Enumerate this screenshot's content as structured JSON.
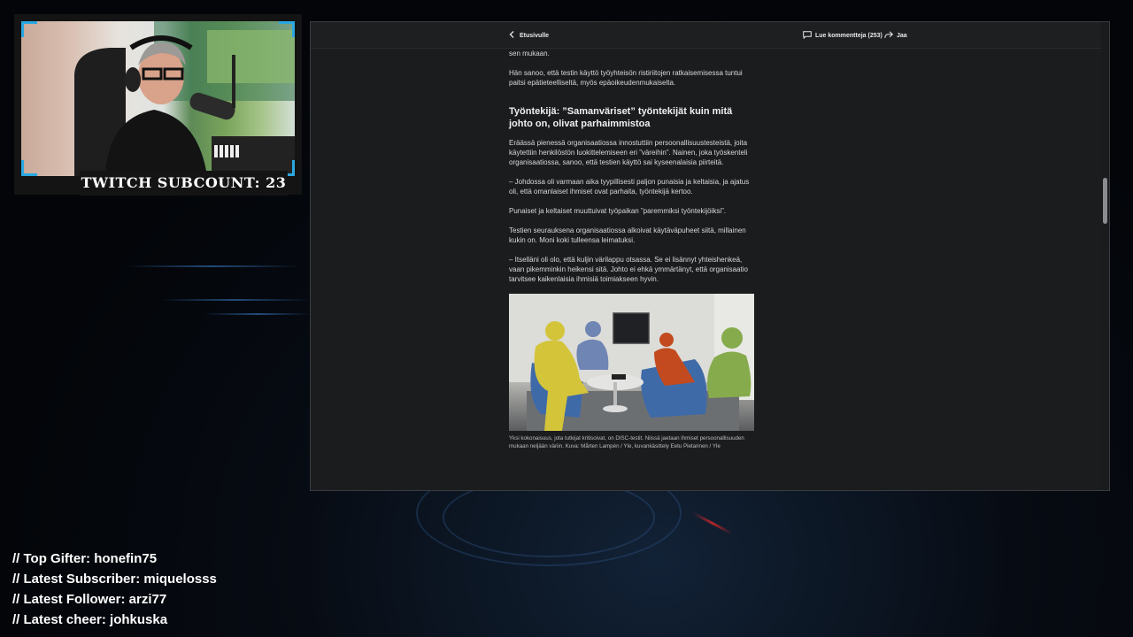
{
  "overlay": {
    "subcount": "TWITCH SUBCOUNT: 23",
    "stats": [
      "// Top Gifter: honefin75",
      "// Latest Subscriber: miquelosss",
      "// Latest Follower: arzi77",
      "// Latest cheer: johkuska"
    ],
    "accent_color": "#2aa8e0"
  },
  "browser": {
    "nav": {
      "back_label": "Etusivulle",
      "comments_label": "Lue kommentteja (253)",
      "share_label": "Jaa"
    },
    "article": {
      "paragraphs_top": [
        "sen mukaan.",
        "Hän sanoo, että testin käyttö työyhteisön ristiriitojen ratkaisemisessa tuntui paitsi epätieteelliseltä, myös epäoikeudenmukaiselta."
      ],
      "heading": "Työntekijä: ”Samanväriset” työntekijät kuin mitä johto on, olivat parhaimmistoa",
      "paragraphs": [
        "Eräässä pienessä organisaatiossa innostuttiin persoonallisuustesteistä, joita käytettiin henkilöstön luokittelemiseen eri ”väreihin”. Nainen, joka työskenteli organisaatiossa, sanoo, että testien käyttö sai kyseenalaisia piirteitä.",
        "– Johdossa oli varmaan aika tyypillisesti paljon punaisia ja keltaisia, ja ajatus oli, että omanlaiset ihmiset ovat parhaita, työntekijä kertoo.",
        "Punaiset ja keltaiset muuttuivat työpaikan ”paremmiksi työntekijöiksi”.",
        "Testien seurauksena organisaatiossa alkoivat käytäväpuheet siitä, millainen kukin on. Moni koki tulleensa leimatuksi.",
        "– Itselläni oli olo, että kuljin värilappu otsassa. Se ei lisännyt yhteishenkeä, vaan pikemminkin heikensi sitä. Johto ei ehkä ymmärtänyt, että organisaatio tarvitsee kaikenlaisia ihmisiä toimiakseen hyvin."
      ],
      "image_caption": "Yksi kokonaisuus, jota tutkijat kritisoivat, on DISC-testit. Niissä jaetaan ihmiset persoonallisuuden mukaan neljään väriin. Kuva: Mårten Lampén / Yle, kuvankäsittely Eetu Pietarinen / Yle",
      "figure_colors": {
        "yellow": "#d4c43a",
        "blue": "#6f86b4",
        "red": "#c24a1e",
        "green": "#86ab4c"
      }
    }
  }
}
